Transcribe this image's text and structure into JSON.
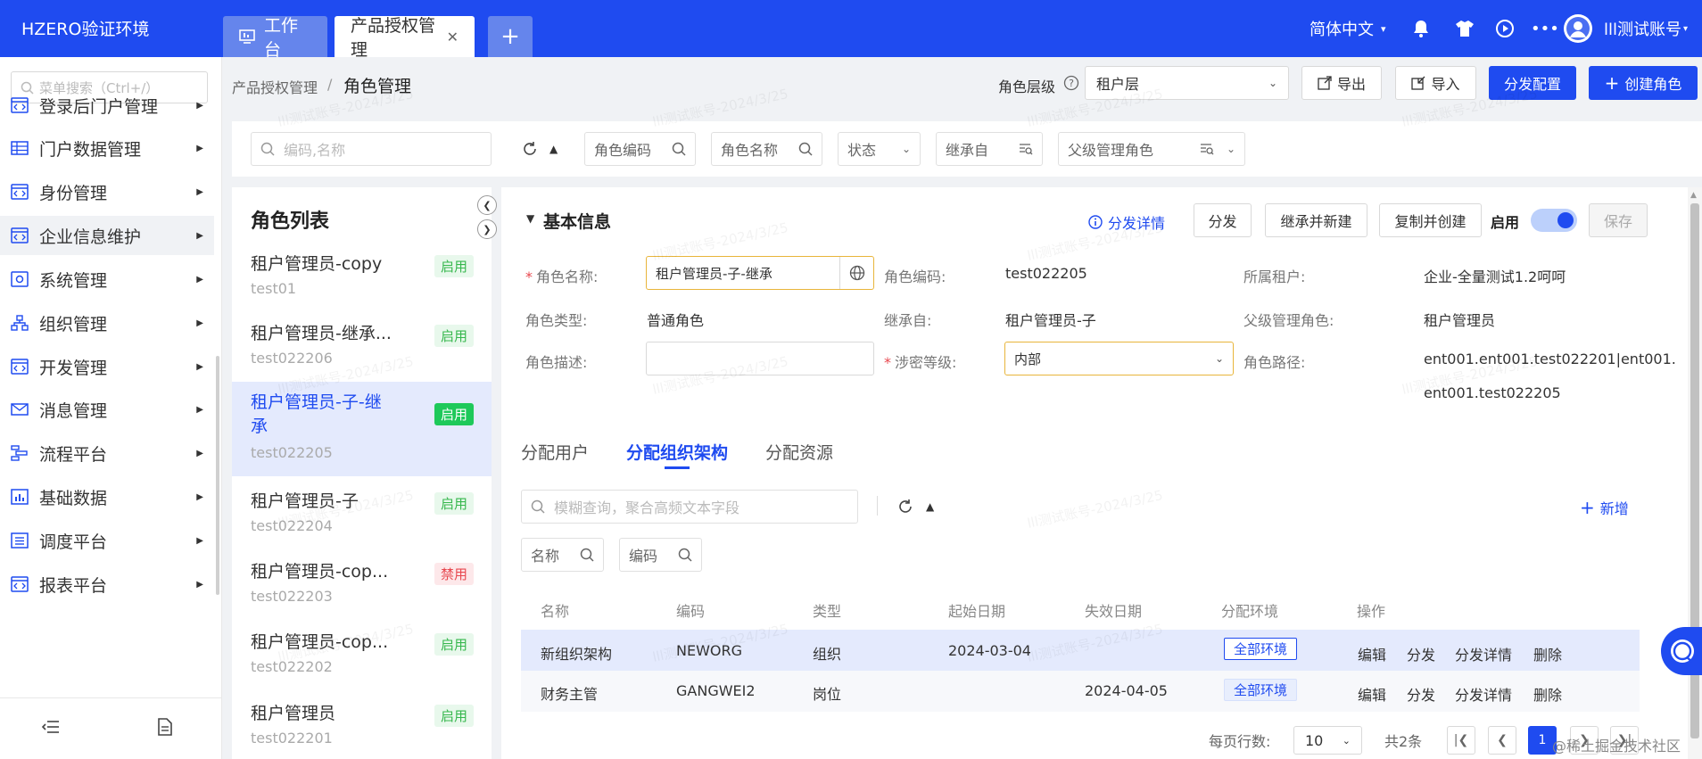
{
  "app": {
    "title": "HZERO验证环境"
  },
  "tabs": [
    {
      "label": "工作台"
    },
    {
      "label": "产品授权管理"
    }
  ],
  "topbar": {
    "language": "简体中文",
    "user": "lll测试账号"
  },
  "sidebar": {
    "search_placeholder": "菜单搜索（Ctrl+/）",
    "items": [
      {
        "label": "登录后门户管理",
        "icon": "code-window-icon"
      },
      {
        "label": "门户数据管理",
        "icon": "table-icon"
      },
      {
        "label": "身份管理",
        "icon": "code-window-icon"
      },
      {
        "label": "企业信息维护",
        "icon": "code-window-icon"
      },
      {
        "label": "系统管理",
        "icon": "gear-box-icon"
      },
      {
        "label": "组织管理",
        "icon": "org-tree-icon"
      },
      {
        "label": "开发管理",
        "icon": "code-window-icon"
      },
      {
        "label": "消息管理",
        "icon": "mail-icon"
      },
      {
        "label": "流程平台",
        "icon": "flow-icon"
      },
      {
        "label": "基础数据",
        "icon": "chart-icon"
      },
      {
        "label": "调度平台",
        "icon": "list-icon"
      },
      {
        "label": "报表平台",
        "icon": "code-window-icon"
      }
    ]
  },
  "header": {
    "breadcrumb_parent": "产品授权管理",
    "breadcrumb_sep": "/",
    "breadcrumb_current": "角色管理",
    "role_level_label": "角色层级",
    "role_level_value": "租户层",
    "export": "导出",
    "import": "导入",
    "distribute_config": "分发配置",
    "create_role": "创建角色"
  },
  "filter": {
    "search_placeholder": "编码,名称",
    "role_code": "角色编码",
    "role_name": "角色名称",
    "status": "状态",
    "inherit_from": "继承自",
    "parent_role": "父级管理角色"
  },
  "role_list": {
    "title": "角色列表",
    "items": [
      {
        "name": "租户管理员-copy",
        "code": "test01",
        "status": "启用"
      },
      {
        "name": "租户管理员-继承...",
        "code": "test022206",
        "status": "启用"
      },
      {
        "name_line1": "租户管理员-子-继",
        "name_line2": "承",
        "code": "test022205",
        "status": "启用"
      },
      {
        "name": "租户管理员-子",
        "code": "test022204",
        "status": "启用"
      },
      {
        "name": "租户管理员-cop...",
        "code": "test022203",
        "status": "禁用"
      },
      {
        "name": "租户管理员-cop...",
        "code": "test022202",
        "status": "启用"
      },
      {
        "name": "租户管理员",
        "code": "test022201",
        "status": "启用"
      }
    ]
  },
  "detail": {
    "section_title": "基本信息",
    "distribute_detail": "分发详情",
    "distribute": "分发",
    "inherit_new": "继承并新建",
    "copy_create": "复制并创建",
    "enable_label": "启用",
    "save": "保存",
    "fields": {
      "role_name_label": "角色名称:",
      "role_name_value": "租户管理员-子-继承",
      "role_code_label": "角色编码:",
      "role_code_value": "test022205",
      "tenant_label": "所属租户:",
      "tenant_value": "企业-全量测试1.2呵呵",
      "role_type_label": "角色类型:",
      "role_type_value": "普通角色",
      "inherit_label": "继承自:",
      "inherit_value": "租户管理员-子",
      "parent_label": "父级管理角色:",
      "parent_value": "租户管理员",
      "desc_label": "角色描述:",
      "secret_label": "涉密等级:",
      "secret_value": "内部",
      "path_label": "角色路径:",
      "path_line1": "ent001.ent001.test022201|ent001.",
      "path_line2": "ent001.test022205"
    },
    "subtabs": [
      "分配用户",
      "分配组织架构",
      "分配资源"
    ],
    "sub_search_placeholder": "模糊查询，聚合高频文本字段",
    "add": "新增",
    "sub_filter": {
      "name": "名称",
      "code": "编码"
    },
    "table": {
      "columns": [
        "名称",
        "编码",
        "类型",
        "起始日期",
        "失效日期",
        "分配环境",
        "操作"
      ],
      "rows": [
        {
          "name": "新组织架构",
          "code": "NEWORG",
          "type": "组织",
          "start": "2024-03-04",
          "end": "",
          "env": "全部环境"
        },
        {
          "name": "财务主管",
          "code": "GANGWEI2",
          "type": "岗位",
          "start": "",
          "end": "2024-04-05",
          "env": "全部环境"
        }
      ],
      "actions": [
        "编辑",
        "分发",
        "分发详情",
        "删除"
      ]
    },
    "pagination": {
      "page_size_label": "每页行数:",
      "page_size": "10",
      "total": "共2条",
      "current_page": "1"
    }
  },
  "watermark_text": "lll测试账号-2024/3/25",
  "footer_mark": "@稀土掘金技术社区",
  "colors": {
    "primary": "#1f4bf0",
    "enabled": "#36b74d",
    "disabled": "#e8484f"
  }
}
